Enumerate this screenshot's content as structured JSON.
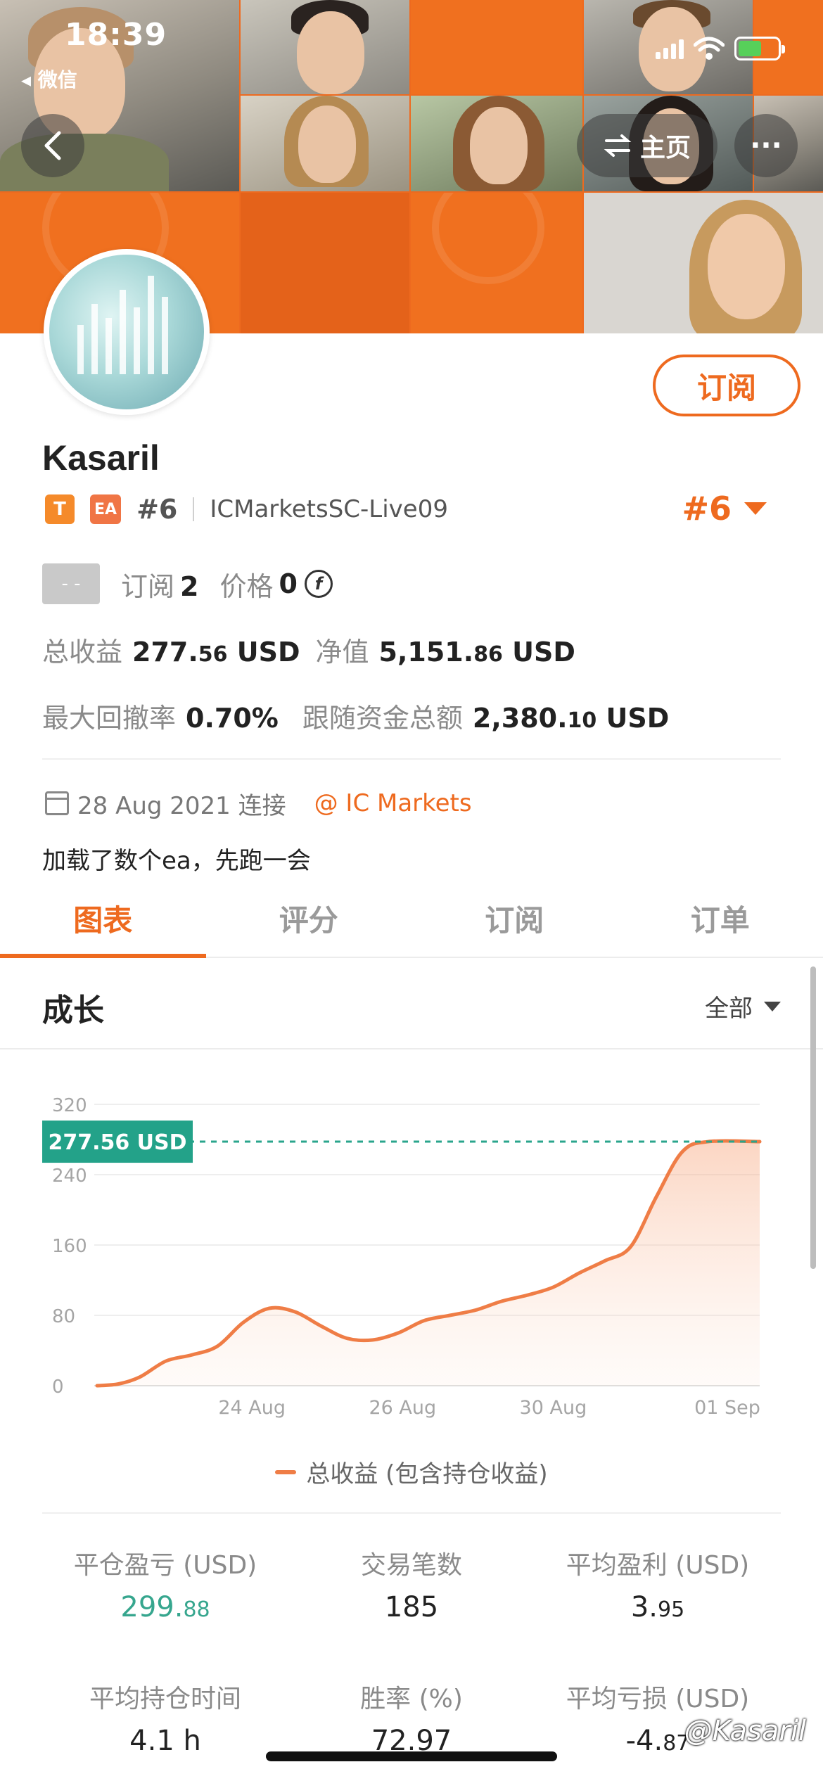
{
  "status_bar": {
    "time": "18:39",
    "back_app": "◂ 微信"
  },
  "header": {
    "home_label": "主页",
    "more_label": "···"
  },
  "profile": {
    "name": "Kasaril",
    "subscribe_label": "订阅",
    "badge_t": "T",
    "badge_ea": "EA",
    "rank_small": "#6",
    "server": "ICMarketsSC-Live09",
    "rank_big": "#6",
    "grey_box": "- -",
    "subscribers_label": "订阅",
    "subscribers_value": "2",
    "price_label": "价格",
    "price_value": "0",
    "coin_symbol": "f",
    "total_profit_label": "总收益",
    "total_profit_int": "277.",
    "total_profit_dec": "56",
    "total_profit_unit": " USD",
    "equity_label": "净值",
    "equity_int": "5,151.",
    "equity_dec": "86",
    "equity_unit": " USD",
    "max_dd_label": "最大回撤率",
    "max_dd_value": "0.70%",
    "follow_funds_label": "跟随资金总额",
    "follow_funds_int": "2,380.",
    "follow_funds_dec": "10",
    "follow_funds_unit": " USD",
    "joined_text": "28 Aug 2021 连接",
    "broker": "@ IC Markets",
    "bio": "加载了数个ea，先跑一会"
  },
  "tabs": [
    {
      "label": "图表",
      "active": true
    },
    {
      "label": "评分",
      "active": false
    },
    {
      "label": "订阅",
      "active": false
    },
    {
      "label": "订单",
      "active": false
    }
  ],
  "growth": {
    "title": "成长",
    "filter_value": "全部"
  },
  "chart_data": {
    "type": "area",
    "current_value_label": "277.56 USD",
    "y_ticks": [
      "320",
      "240",
      "160",
      "80",
      "0"
    ],
    "ylim": [
      0,
      320
    ],
    "x_tick_labels": [
      "24 Aug",
      "26 Aug",
      "30 Aug",
      "01 Sep"
    ],
    "legend": "总收益 (包含持仓收益)",
    "series": [
      {
        "name": "总收益 (包含持仓收益)",
        "color": "#ef7d46",
        "points": [
          [
            0,
            0
          ],
          [
            0.5,
            2
          ],
          [
            1,
            10
          ],
          [
            1.6,
            28
          ],
          [
            2.2,
            35
          ],
          [
            2.8,
            45
          ],
          [
            3.4,
            72
          ],
          [
            4.0,
            88
          ],
          [
            4.6,
            84
          ],
          [
            5.2,
            68
          ],
          [
            5.8,
            54
          ],
          [
            6.4,
            52
          ],
          [
            7.0,
            60
          ],
          [
            7.6,
            74
          ],
          [
            8.2,
            80
          ],
          [
            8.8,
            86
          ],
          [
            9.4,
            96
          ],
          [
            10.0,
            103
          ],
          [
            10.6,
            112
          ],
          [
            11.2,
            128
          ],
          [
            11.8,
            142
          ],
          [
            12.4,
            158
          ],
          [
            13.0,
            215
          ],
          [
            13.6,
            266
          ],
          [
            14.2,
            277.56
          ],
          [
            15.4,
            277.56
          ]
        ]
      }
    ]
  },
  "stats": [
    {
      "label": "平仓盈亏 (USD)",
      "int": "299.",
      "dec": "88",
      "green": true
    },
    {
      "label": "交易笔数",
      "int": "185",
      "dec": "",
      "green": false
    },
    {
      "label": "平均盈利 (USD)",
      "int": "3.",
      "dec": "95",
      "green": false
    },
    {
      "label": "平均持仓时间",
      "int": "4.1 h",
      "dec": "",
      "green": false
    },
    {
      "label": "胜率 (%)",
      "int": "72.97",
      "dec": "",
      "green": false
    },
    {
      "label": "平均亏损 (USD)",
      "int": "-4.",
      "dec": "87",
      "green": false
    }
  ],
  "watermark": "@Kasaril"
}
